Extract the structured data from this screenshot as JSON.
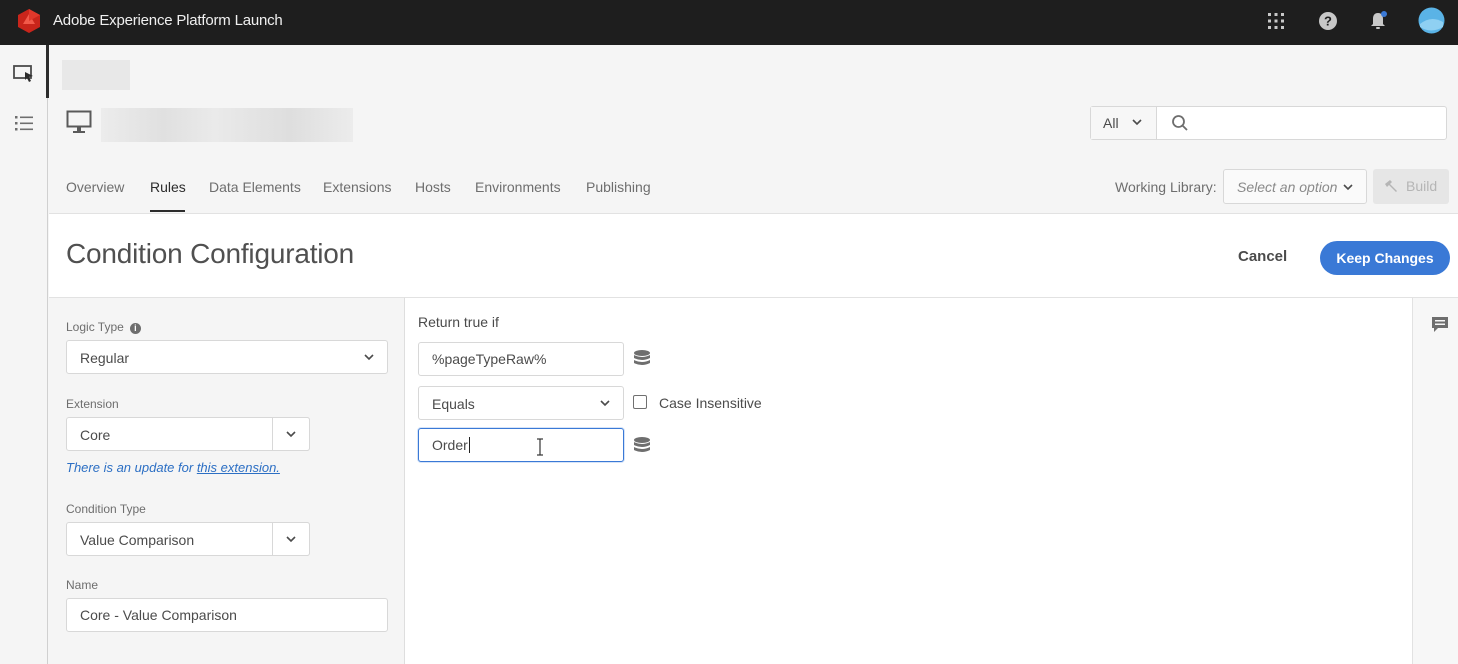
{
  "app": {
    "title": "Adobe Experience Platform Launch"
  },
  "topbar": {
    "icons": [
      "apps-grid-icon",
      "help-icon",
      "notifications-bell-icon",
      "user-avatar"
    ]
  },
  "rail": {
    "items": [
      "properties-icon",
      "list-icon"
    ]
  },
  "search": {
    "filter": "All",
    "placeholder": ""
  },
  "tabs": [
    {
      "label": "Overview",
      "active": false
    },
    {
      "label": "Rules",
      "active": true
    },
    {
      "label": "Data Elements",
      "active": false
    },
    {
      "label": "Extensions",
      "active": false
    },
    {
      "label": "Hosts",
      "active": false
    },
    {
      "label": "Environments",
      "active": false
    },
    {
      "label": "Publishing",
      "active": false
    }
  ],
  "working_library": {
    "label": "Working Library:",
    "placeholder": "Select an option",
    "build_label": "Build"
  },
  "page": {
    "title": "Condition Configuration",
    "cancel_label": "Cancel",
    "keep_label": "Keep Changes"
  },
  "left": {
    "logic_type_label": "Logic Type",
    "logic_type_value": "Regular",
    "extension_label": "Extension",
    "extension_value": "Core",
    "update_note": "There is an update for ",
    "update_link": "this extension.",
    "condition_type_label": "Condition Type",
    "condition_type_value": "Value Comparison",
    "name_label": "Name",
    "name_value": "Core - Value Comparison"
  },
  "condition": {
    "return_label": "Return true if",
    "left_operand": "%pageTypeRaw%",
    "operator": "Equals",
    "case_insensitive_label": "Case Insensitive",
    "case_insensitive": false,
    "right_operand": "Order"
  },
  "colors": {
    "accent": "#3a79d6",
    "topbar": "#1e1e1e",
    "brand": "#eb1000"
  }
}
